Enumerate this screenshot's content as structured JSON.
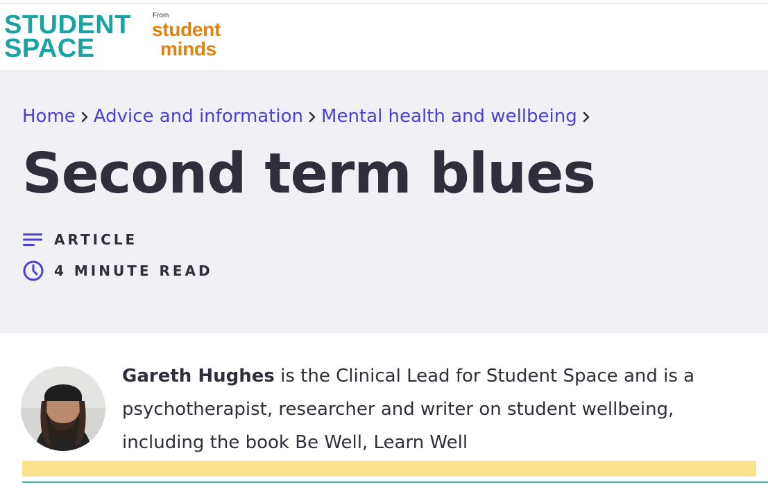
{
  "header": {
    "logo_line1": "STUDENT",
    "logo_line2": "SPACE",
    "from_label": "From",
    "partner_line1": "student",
    "partner_line2": "minds"
  },
  "breadcrumb": {
    "items": [
      "Home",
      "Advice and information",
      "Mental health and wellbeing"
    ]
  },
  "page": {
    "title": "Second term blues",
    "type_label": "ARTICLE",
    "read_time": "4 MINUTE READ"
  },
  "author": {
    "name": "Gareth Hughes",
    "bio": " is the Clinical Lead for Student Space and is a psychotherapist, researcher and writer on student wellbeing, including the book Be Well, Learn Well"
  },
  "colors": {
    "brand_teal": "#1aa3a3",
    "brand_orange": "#e0820d",
    "link_purple": "#4a3fd6",
    "hero_bg": "#f1f1f5",
    "highlight": "#fbe28c"
  },
  "icons": {
    "article": "lines-icon",
    "read_time": "clock-icon",
    "breadcrumb_separator": "chevron-right-icon"
  }
}
